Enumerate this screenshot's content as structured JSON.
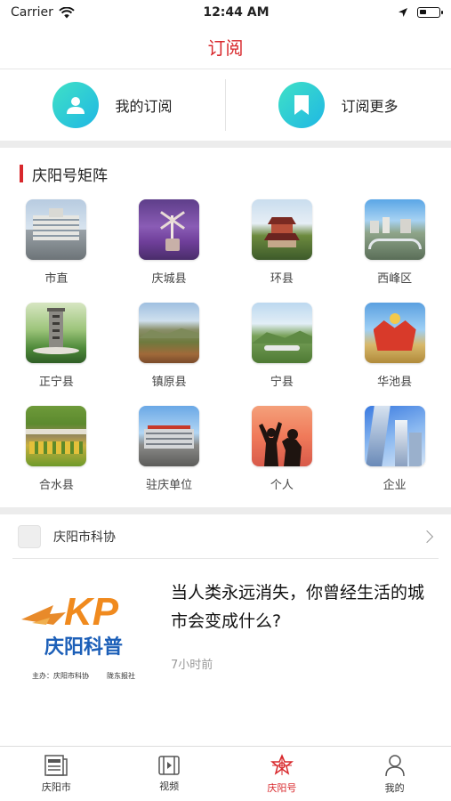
{
  "status": {
    "carrier": "Carrier",
    "time": "12:44 AM"
  },
  "nav": {
    "title": "订阅"
  },
  "subscribe": {
    "mine": "我的订阅",
    "more": "订阅更多"
  },
  "matrix": {
    "title": "庆阳号矩阵",
    "items": [
      {
        "label": "市直"
      },
      {
        "label": "庆城县"
      },
      {
        "label": "环县"
      },
      {
        "label": "西峰区"
      },
      {
        "label": "正宁县"
      },
      {
        "label": "镇原县"
      },
      {
        "label": "宁县"
      },
      {
        "label": "华池县"
      },
      {
        "label": "合水县"
      },
      {
        "label": "驻庆单位"
      },
      {
        "label": "个人"
      },
      {
        "label": "企业"
      }
    ]
  },
  "feed": {
    "source": "庆阳市科协",
    "article": {
      "title": "当人类永远消失，你曾经生活的城市会变成什么?",
      "time": "7小时前",
      "logo_letters": "KP",
      "logo_text": "庆阳科普",
      "logo_sponsor": "主办：庆阳市科协",
      "logo_partner": "陇东报社"
    }
  },
  "tabs": [
    {
      "label": "庆阳市",
      "icon": "newspaper-icon"
    },
    {
      "label": "视频",
      "icon": "film-icon"
    },
    {
      "label": "庆阳号",
      "icon": "emblem-icon"
    },
    {
      "label": "我的",
      "icon": "person-icon"
    }
  ],
  "colors": {
    "accent": "#d8282c",
    "teal_start": "#3fe1c6",
    "teal_end": "#1fb7e4"
  }
}
